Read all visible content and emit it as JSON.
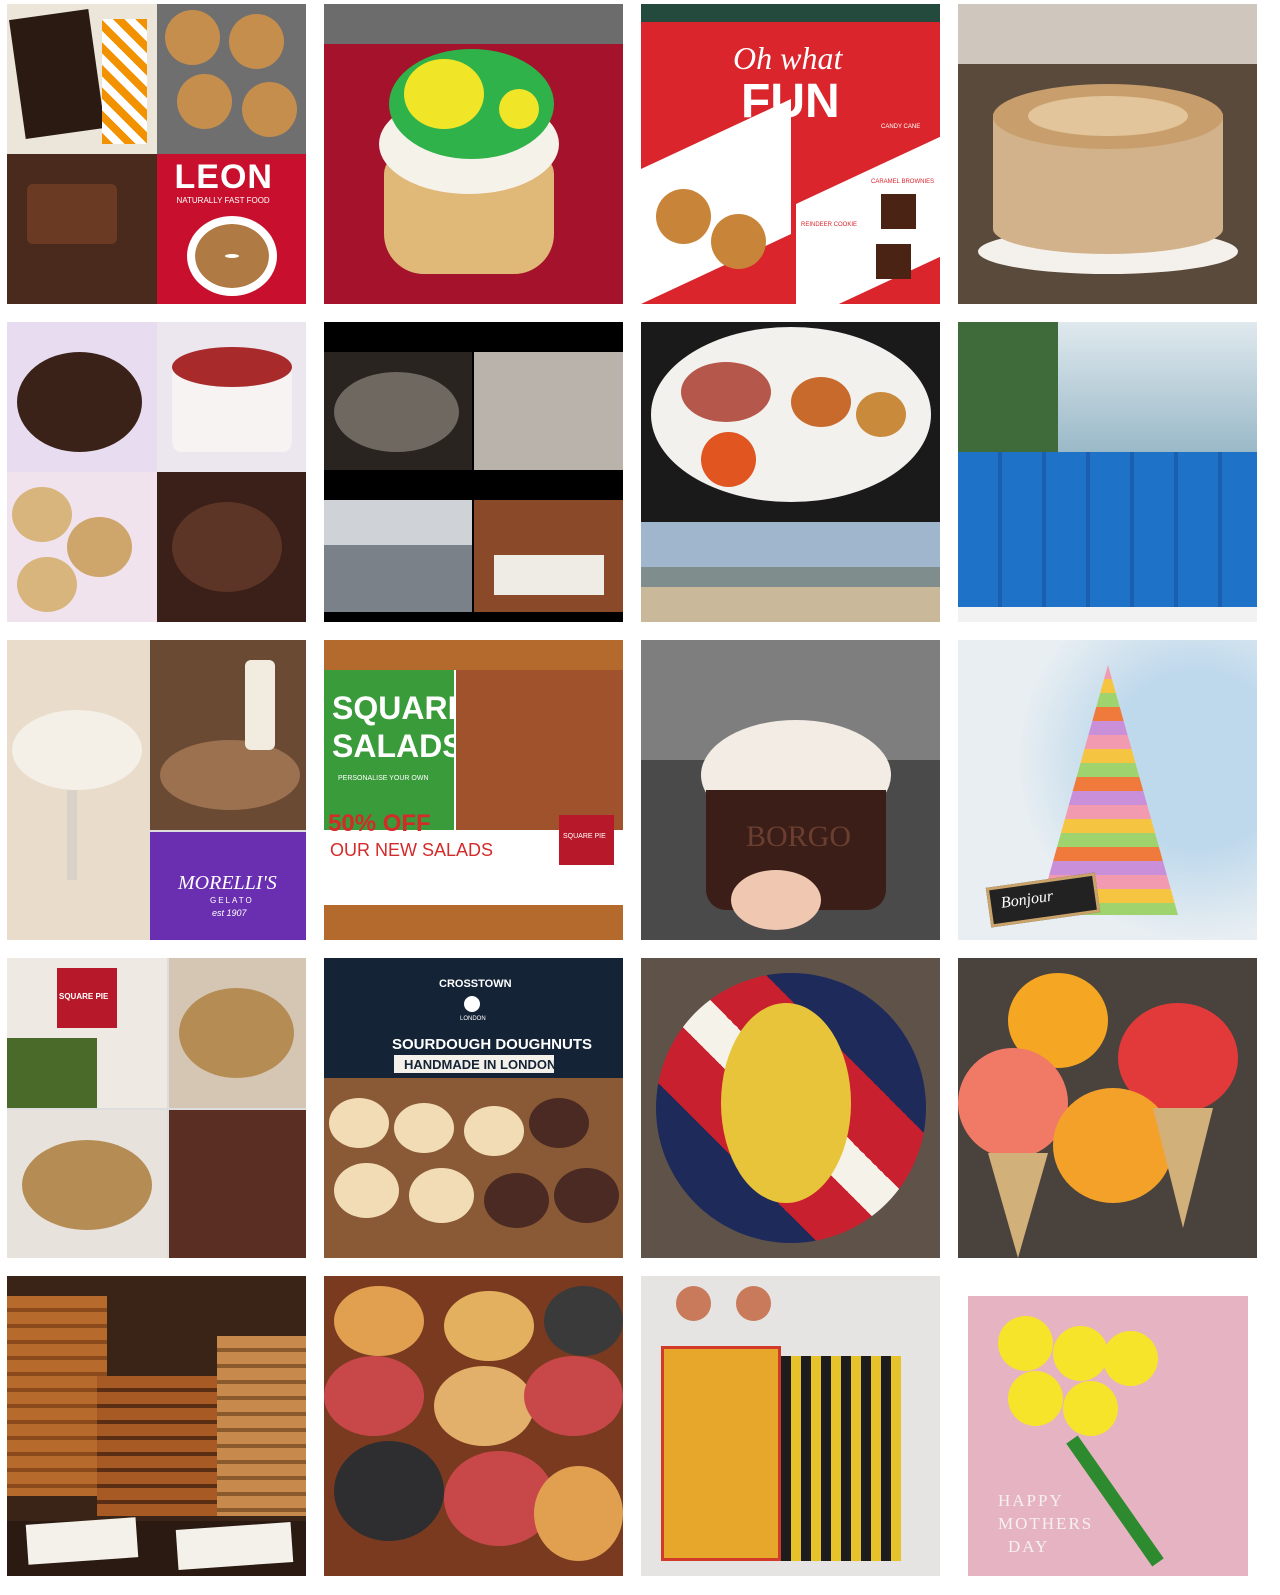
{
  "gallery": {
    "tiles": [
      {
        "id": "leon",
        "texts": {
          "brand": "LEON",
          "tagline": "NATURALLY FAST FOOD"
        }
      },
      {
        "id": "pacman-cupcake",
        "texts": {}
      },
      {
        "id": "oh-what-fun",
        "texts": {
          "line1": "Oh what",
          "line2": "FUN",
          "candy": "CANDY CANE",
          "caramel": "CARAMEL BROWNIES",
          "reindeer": "REINDEER COOKIE"
        }
      },
      {
        "id": "caramel-drip-cake",
        "texts": {}
      },
      {
        "id": "cake-collage",
        "texts": {}
      },
      {
        "id": "hotel-collage",
        "texts": {}
      },
      {
        "id": "breakfast-beach",
        "texts": {}
      },
      {
        "id": "rooftop-pool",
        "texts": {}
      },
      {
        "id": "morellis",
        "texts": {
          "brand": "MORELLI'S",
          "sub": "GELATO",
          "est": "est 1907"
        }
      },
      {
        "id": "square-salads",
        "texts": {
          "line1": "SQUARE",
          "line2": "SALADS",
          "sub": "PERSONALISE YOUR OWN",
          "offer": "50% OFF",
          "offer2": "OUR NEW SALADS",
          "badge": "SQUARE PIE"
        }
      },
      {
        "id": "borgo-gelato",
        "texts": {
          "cup": "BORGO"
        }
      },
      {
        "id": "macaron-tower",
        "texts": {
          "sign": "Bonjour"
        }
      },
      {
        "id": "square-pie-collage",
        "texts": {
          "sign": "SQUARE PIE"
        }
      },
      {
        "id": "crosstown",
        "texts": {
          "brand": "CROSSTOWN",
          "sub": "LONDON",
          "line1": "SOURDOUGH DOUGHNUTS",
          "line2": "HANDMADE IN LONDON"
        }
      },
      {
        "id": "queen-cake",
        "texts": {}
      },
      {
        "id": "rose-cones",
        "texts": {}
      },
      {
        "id": "cookie-stacks",
        "texts": {}
      },
      {
        "id": "cronuts",
        "texts": {}
      },
      {
        "id": "figurine-cake",
        "texts": {}
      },
      {
        "id": "mothers-day",
        "texts": {
          "msg1": "HAPPY",
          "msg2": "MOTHERS",
          "msg3": "DAY"
        }
      }
    ]
  }
}
